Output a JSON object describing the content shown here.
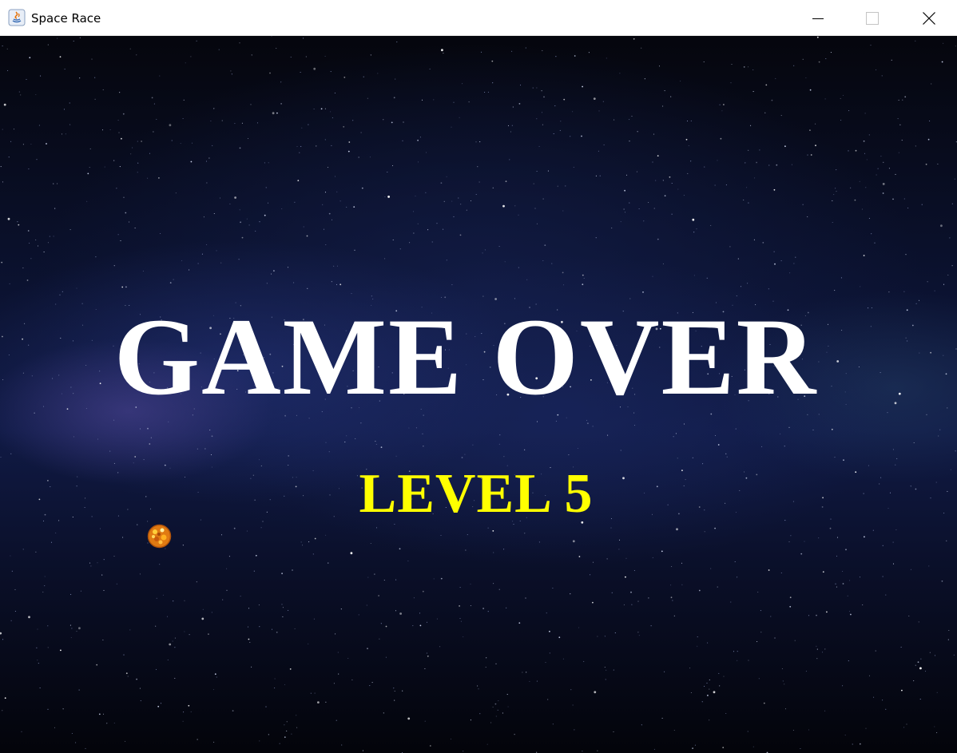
{
  "window": {
    "title": "Space Race",
    "app_icon": "java-icon",
    "controls": [
      "minimize-icon",
      "maximize-icon",
      "close-icon"
    ]
  },
  "game": {
    "headline": "GAME OVER",
    "level_text": "LEVEL 5",
    "headline_color": "#ffffff",
    "level_color": "#ffff00",
    "asteroid_icon": "asteroid-icon"
  }
}
